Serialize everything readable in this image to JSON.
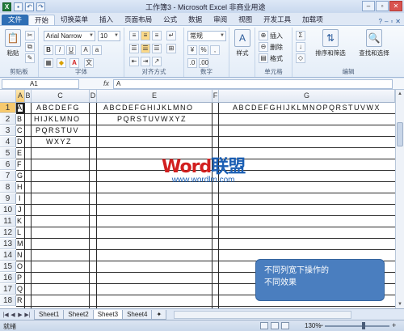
{
  "app": {
    "title": "工作簿3 - Microsoft Excel 非商业用途"
  },
  "quick_access": [
    "save-icon",
    "undo-icon",
    "redo-icon"
  ],
  "ribbon_tabs": [
    "文件",
    "开始",
    "切换菜单",
    "插入",
    "页面布局",
    "公式",
    "数据",
    "审阅",
    "视图",
    "开发工具",
    "加载项"
  ],
  "ribbon": {
    "clipboard": {
      "paste": "粘贴",
      "label": "剪贴板"
    },
    "font": {
      "name": "Arial Narrow",
      "size": "10",
      "label": "字体"
    },
    "alignment": {
      "label": "对齐方式"
    },
    "number": {
      "format": "常规",
      "label": "数字"
    },
    "styles": {
      "label": "样式"
    },
    "cells": {
      "insert": "插入",
      "delete": "删除",
      "format": "格式",
      "label": "单元格"
    },
    "editing": {
      "sort": "排序和筛选",
      "find": "查找和选择",
      "label": "编辑"
    }
  },
  "formula": {
    "name_box": "A1",
    "fx": "fx",
    "value": "A"
  },
  "columns": [
    "A",
    "B",
    "C",
    "D",
    "E",
    "F",
    "G"
  ],
  "rows": [
    "1",
    "2",
    "3",
    "4",
    "5",
    "6",
    "7",
    "8",
    "9",
    "10",
    "11",
    "12",
    "13",
    "14",
    "15",
    "16",
    "17",
    "18"
  ],
  "cells": {
    "A1": "A",
    "B1": "B",
    "C1": "C",
    "D1": "D",
    "E1": "E",
    "F1": "F",
    "G1": "G",
    "H1": "H",
    "I1": "I",
    "J1": "J",
    "K1": "K",
    "L1": "L",
    "M1": "M",
    "N1": "N",
    "O1": "O",
    "P1": "P",
    "Q1": "Q",
    "R1": "R",
    "C1v": "ABCDEFG",
    "C2v": "HIJKLMNO",
    "C3v": "PQRSTUV",
    "C4v": "WXYZ",
    "E1v": "ABCDEFGHIJKLMNO",
    "E2v": "PQRSTUVWXYZ",
    "G1v": "ABCDEFGHIJKLMNOPQRSTUVWX"
  },
  "sheets": [
    "Sheet1",
    "Sheet2",
    "Sheet3",
    "Sheet4"
  ],
  "active_sheet": "Sheet3",
  "status": {
    "ready": "就绪",
    "zoom": "130%"
  },
  "watermark": {
    "word": "Word",
    "brand": "联盟",
    "url": "www.wordlm.com"
  },
  "note": {
    "line1": "不同列宽下操作的",
    "line2": "不同效果"
  }
}
